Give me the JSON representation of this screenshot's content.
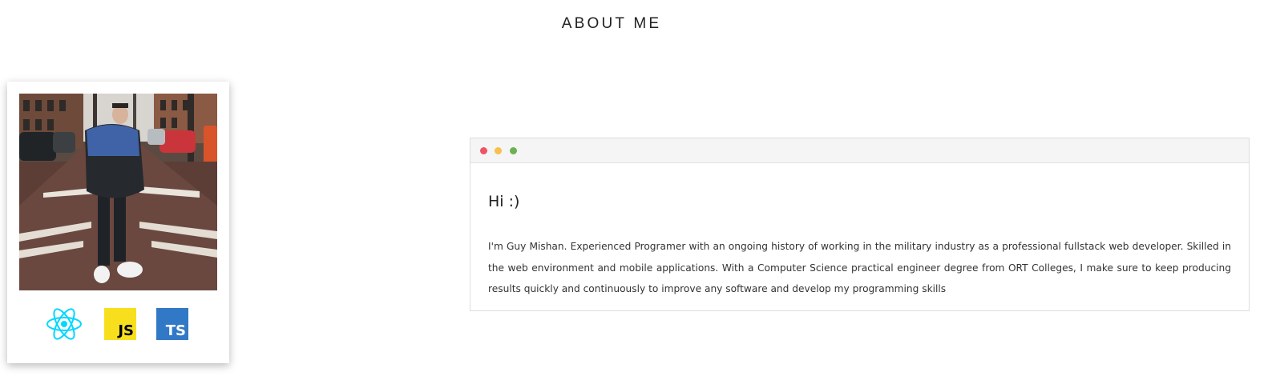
{
  "section": {
    "title": "ABOUT ME"
  },
  "profile": {
    "photo_icon": "profile-photo",
    "tech_icons": [
      {
        "name": "react-icon",
        "color": "#00d8ff"
      },
      {
        "name": "javascript-icon",
        "label": "JS",
        "color": "#f7df1e"
      },
      {
        "name": "typescript-icon",
        "label": "TS",
        "color": "#3178c6"
      }
    ]
  },
  "window": {
    "dots": [
      "#ef5466",
      "#f7c04b",
      "#6ab150"
    ],
    "greeting": "Hi :)",
    "bio": "I'm Guy Mishan. Experienced Programer with an ongoing history of working in the military industry as a professional fullstack web developer. Skilled in the web environment and mobile applications. With a Computer Science practical engineer degree from ORT Colleges, I make sure to keep producing results quickly and continuously to improve any software and develop my programming skills"
  }
}
